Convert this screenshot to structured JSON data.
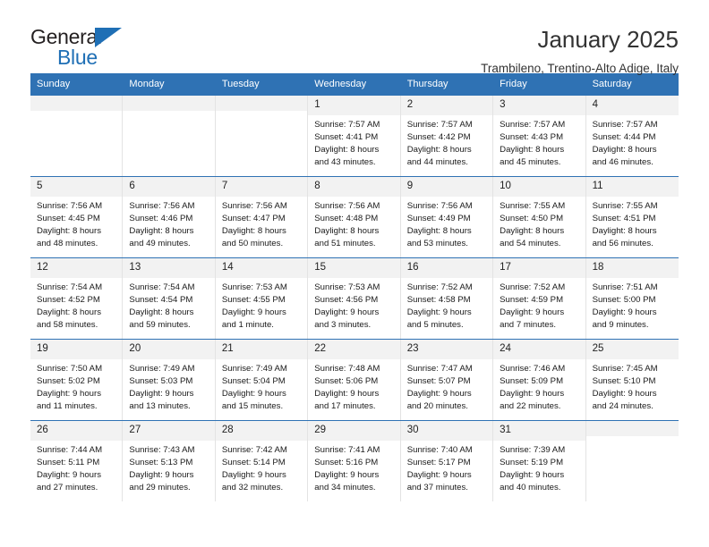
{
  "brand": {
    "name_top": "General",
    "name_bottom": "Blue",
    "accent_color": "#1f6fb5"
  },
  "header": {
    "title": "January 2025",
    "subtitle": "Trambileno, Trentino-Alto Adige, Italy"
  },
  "theme": {
    "header_bar_color": "#2f72b4",
    "daynum_band_color": "#f2f2f2",
    "text_color": "#222222"
  },
  "weekdays": [
    "Sunday",
    "Monday",
    "Tuesday",
    "Wednesday",
    "Thursday",
    "Friday",
    "Saturday"
  ],
  "weeks": [
    [
      {
        "day": "",
        "empty": true
      },
      {
        "day": "",
        "empty": true
      },
      {
        "day": "",
        "empty": true
      },
      {
        "day": "1",
        "sunrise": "Sunrise: 7:57 AM",
        "sunset": "Sunset: 4:41 PM",
        "daylight": "Daylight: 8 hours and 43 minutes."
      },
      {
        "day": "2",
        "sunrise": "Sunrise: 7:57 AM",
        "sunset": "Sunset: 4:42 PM",
        "daylight": "Daylight: 8 hours and 44 minutes."
      },
      {
        "day": "3",
        "sunrise": "Sunrise: 7:57 AM",
        "sunset": "Sunset: 4:43 PM",
        "daylight": "Daylight: 8 hours and 45 minutes."
      },
      {
        "day": "4",
        "sunrise": "Sunrise: 7:57 AM",
        "sunset": "Sunset: 4:44 PM",
        "daylight": "Daylight: 8 hours and 46 minutes."
      }
    ],
    [
      {
        "day": "5",
        "sunrise": "Sunrise: 7:56 AM",
        "sunset": "Sunset: 4:45 PM",
        "daylight": "Daylight: 8 hours and 48 minutes."
      },
      {
        "day": "6",
        "sunrise": "Sunrise: 7:56 AM",
        "sunset": "Sunset: 4:46 PM",
        "daylight": "Daylight: 8 hours and 49 minutes."
      },
      {
        "day": "7",
        "sunrise": "Sunrise: 7:56 AM",
        "sunset": "Sunset: 4:47 PM",
        "daylight": "Daylight: 8 hours and 50 minutes."
      },
      {
        "day": "8",
        "sunrise": "Sunrise: 7:56 AM",
        "sunset": "Sunset: 4:48 PM",
        "daylight": "Daylight: 8 hours and 51 minutes."
      },
      {
        "day": "9",
        "sunrise": "Sunrise: 7:56 AM",
        "sunset": "Sunset: 4:49 PM",
        "daylight": "Daylight: 8 hours and 53 minutes."
      },
      {
        "day": "10",
        "sunrise": "Sunrise: 7:55 AM",
        "sunset": "Sunset: 4:50 PM",
        "daylight": "Daylight: 8 hours and 54 minutes."
      },
      {
        "day": "11",
        "sunrise": "Sunrise: 7:55 AM",
        "sunset": "Sunset: 4:51 PM",
        "daylight": "Daylight: 8 hours and 56 minutes."
      }
    ],
    [
      {
        "day": "12",
        "sunrise": "Sunrise: 7:54 AM",
        "sunset": "Sunset: 4:52 PM",
        "daylight": "Daylight: 8 hours and 58 minutes."
      },
      {
        "day": "13",
        "sunrise": "Sunrise: 7:54 AM",
        "sunset": "Sunset: 4:54 PM",
        "daylight": "Daylight: 8 hours and 59 minutes."
      },
      {
        "day": "14",
        "sunrise": "Sunrise: 7:53 AM",
        "sunset": "Sunset: 4:55 PM",
        "daylight": "Daylight: 9 hours and 1 minute."
      },
      {
        "day": "15",
        "sunrise": "Sunrise: 7:53 AM",
        "sunset": "Sunset: 4:56 PM",
        "daylight": "Daylight: 9 hours and 3 minutes."
      },
      {
        "day": "16",
        "sunrise": "Sunrise: 7:52 AM",
        "sunset": "Sunset: 4:58 PM",
        "daylight": "Daylight: 9 hours and 5 minutes."
      },
      {
        "day": "17",
        "sunrise": "Sunrise: 7:52 AM",
        "sunset": "Sunset: 4:59 PM",
        "daylight": "Daylight: 9 hours and 7 minutes."
      },
      {
        "day": "18",
        "sunrise": "Sunrise: 7:51 AM",
        "sunset": "Sunset: 5:00 PM",
        "daylight": "Daylight: 9 hours and 9 minutes."
      }
    ],
    [
      {
        "day": "19",
        "sunrise": "Sunrise: 7:50 AM",
        "sunset": "Sunset: 5:02 PM",
        "daylight": "Daylight: 9 hours and 11 minutes."
      },
      {
        "day": "20",
        "sunrise": "Sunrise: 7:49 AM",
        "sunset": "Sunset: 5:03 PM",
        "daylight": "Daylight: 9 hours and 13 minutes."
      },
      {
        "day": "21",
        "sunrise": "Sunrise: 7:49 AM",
        "sunset": "Sunset: 5:04 PM",
        "daylight": "Daylight: 9 hours and 15 minutes."
      },
      {
        "day": "22",
        "sunrise": "Sunrise: 7:48 AM",
        "sunset": "Sunset: 5:06 PM",
        "daylight": "Daylight: 9 hours and 17 minutes."
      },
      {
        "day": "23",
        "sunrise": "Sunrise: 7:47 AM",
        "sunset": "Sunset: 5:07 PM",
        "daylight": "Daylight: 9 hours and 20 minutes."
      },
      {
        "day": "24",
        "sunrise": "Sunrise: 7:46 AM",
        "sunset": "Sunset: 5:09 PM",
        "daylight": "Daylight: 9 hours and 22 minutes."
      },
      {
        "day": "25",
        "sunrise": "Sunrise: 7:45 AM",
        "sunset": "Sunset: 5:10 PM",
        "daylight": "Daylight: 9 hours and 24 minutes."
      }
    ],
    [
      {
        "day": "26",
        "sunrise": "Sunrise: 7:44 AM",
        "sunset": "Sunset: 5:11 PM",
        "daylight": "Daylight: 9 hours and 27 minutes."
      },
      {
        "day": "27",
        "sunrise": "Sunrise: 7:43 AM",
        "sunset": "Sunset: 5:13 PM",
        "daylight": "Daylight: 9 hours and 29 minutes."
      },
      {
        "day": "28",
        "sunrise": "Sunrise: 7:42 AM",
        "sunset": "Sunset: 5:14 PM",
        "daylight": "Daylight: 9 hours and 32 minutes."
      },
      {
        "day": "29",
        "sunrise": "Sunrise: 7:41 AM",
        "sunset": "Sunset: 5:16 PM",
        "daylight": "Daylight: 9 hours and 34 minutes."
      },
      {
        "day": "30",
        "sunrise": "Sunrise: 7:40 AM",
        "sunset": "Sunset: 5:17 PM",
        "daylight": "Daylight: 9 hours and 37 minutes."
      },
      {
        "day": "31",
        "sunrise": "Sunrise: 7:39 AM",
        "sunset": "Sunset: 5:19 PM",
        "daylight": "Daylight: 9 hours and 40 minutes."
      },
      {
        "day": "",
        "empty": true
      }
    ]
  ]
}
